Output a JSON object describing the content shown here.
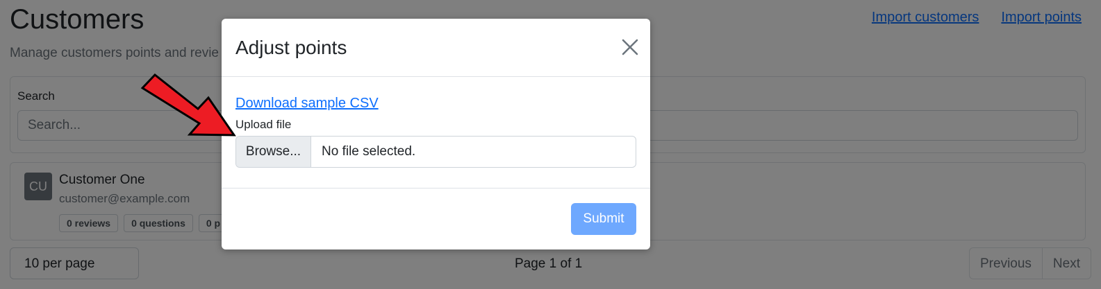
{
  "page": {
    "title": "Customers",
    "subtitle": "Manage customers points and revie",
    "header_links": [
      "Import customers",
      "Import points"
    ]
  },
  "search": {
    "label": "Search",
    "placeholder": "Search..."
  },
  "customer": {
    "initials": "CU",
    "name": "Customer One",
    "email": "customer@example.com",
    "badges": [
      "0 reviews",
      "0 questions",
      "0 p"
    ]
  },
  "pagination": {
    "per_page": "10 per page",
    "page_indicator": "Page 1 of 1",
    "previous": "Previous",
    "next": "Next"
  },
  "modal": {
    "title": "Adjust points",
    "sample_link": "Download sample CSV",
    "upload_label": "Upload file",
    "browse_label": "Browse...",
    "file_status": "No file selected.",
    "submit_label": "Submit"
  },
  "colors": {
    "link": "#0d6efd",
    "submit": "#6ea8fe",
    "annotation_arrow": "#ed1c24"
  },
  "icons": {
    "close": "close-icon",
    "annotation": "red-arrow-icon"
  }
}
